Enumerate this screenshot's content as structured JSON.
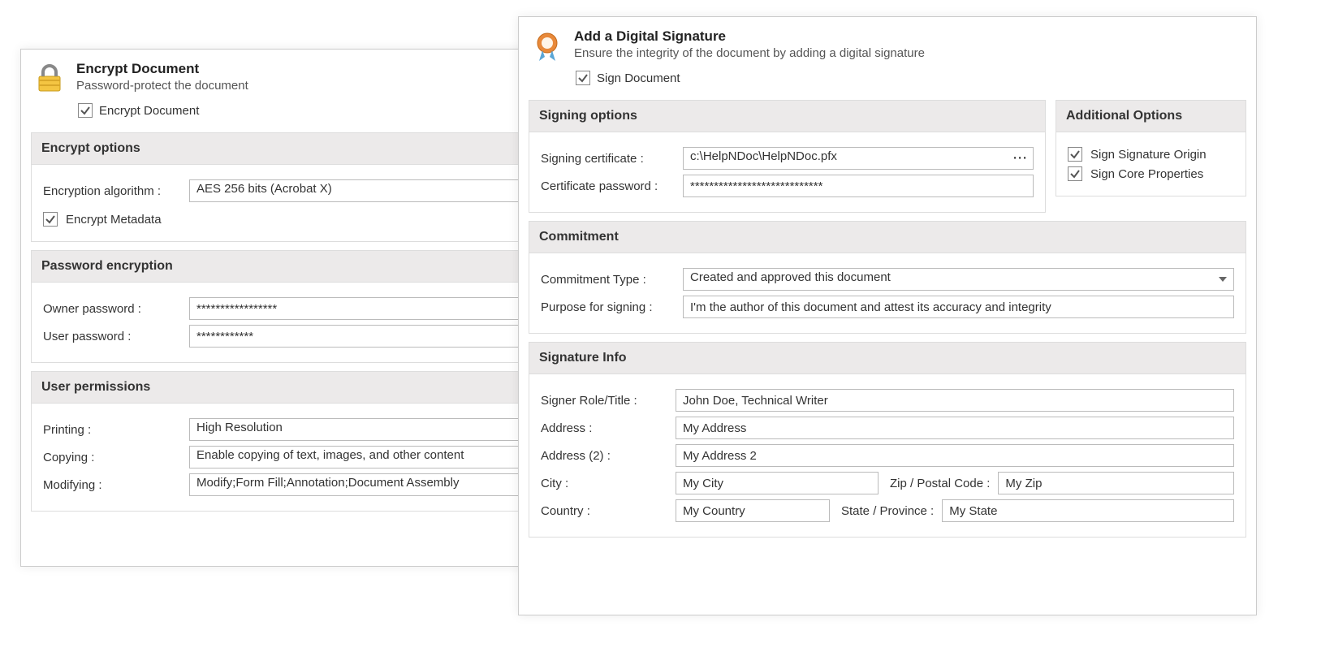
{
  "encrypt": {
    "title": "Encrypt Document",
    "subtitle": "Password-protect the document",
    "main_checkbox_label": "Encrypt Document",
    "options_head": "Encrypt options",
    "algo_label": "Encryption algorithm :",
    "algo_value": "AES 256 bits (Acrobat X)",
    "encrypt_metadata_label": "Encrypt Metadata",
    "pwd_head": "Password encryption",
    "owner_pwd_label": "Owner password :",
    "owner_pwd_value": "*****************",
    "user_pwd_label": "User password :",
    "user_pwd_value": "************",
    "perm_head": "User permissions",
    "printing_label": "Printing :",
    "printing_value": "High Resolution",
    "copying_label": "Copying :",
    "copying_value": "Enable copying of text, images, and other content",
    "modifying_label": "Modifying :",
    "modifying_value": "Modify;Form Fill;Annotation;Document Assembly"
  },
  "sign": {
    "title": "Add a Digital Signature",
    "subtitle": "Ensure the integrity of the document by adding a digital signature",
    "main_checkbox_label": "Sign Document",
    "signing_head": "Signing options",
    "cert_label": "Signing certificate :",
    "cert_value": "c:\\HelpNDoc\\HelpNDoc.pfx",
    "cert_pwd_label": "Certificate password :",
    "cert_pwd_value": "****************************",
    "add_opts_head": "Additional Options",
    "sign_origin_label": "Sign Signature Origin",
    "sign_core_label": "Sign Core Properties",
    "commit_head": "Commitment",
    "commit_type_label": "Commitment Type :",
    "commit_type_value": "Created and approved this document",
    "purpose_label": "Purpose for signing :",
    "purpose_value": "I'm the author of this document and attest its accuracy and integrity",
    "siginfo_head": "Signature Info",
    "role_label": "Signer Role/Title :",
    "role_value": "John Doe, Technical Writer",
    "addr_label": "Address :",
    "addr_value": "My Address",
    "addr2_label": "Address (2) :",
    "addr2_value": "My Address 2",
    "city_label": "City :",
    "city_value": "My City",
    "zip_label": "Zip / Postal Code :",
    "zip_value": "My Zip",
    "country_label": "Country :",
    "country_value": "My Country",
    "state_label": "State / Province :",
    "state_value": "My State"
  }
}
